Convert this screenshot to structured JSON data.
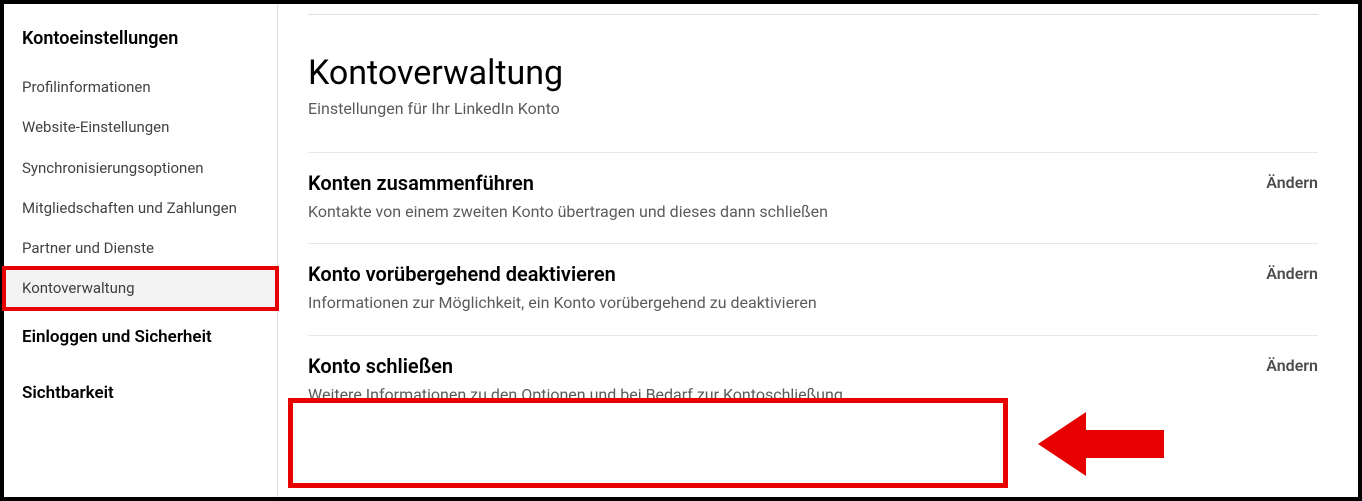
{
  "sidebar": {
    "group1_title": "Kontoeinstellungen",
    "items": [
      {
        "label": "Profilinformationen"
      },
      {
        "label": "Website-Einstellungen"
      },
      {
        "label": "Synchronisierungsoptionen"
      },
      {
        "label": "Mitgliedschaften und Zahlungen"
      },
      {
        "label": "Partner und Dienste"
      },
      {
        "label": "Kontoverwaltung"
      }
    ],
    "group2_title": "Einloggen und Sicherheit",
    "group3_title": "Sichtbarkeit"
  },
  "main": {
    "title": "Kontoverwaltung",
    "subtitle": "Einstellungen für Ihr LinkedIn Konto",
    "action_label": "Ändern",
    "rows": [
      {
        "title": "Konten zusammenführen",
        "desc": "Kontakte von einem zweiten Konto übertragen und dieses dann schließen"
      },
      {
        "title": "Konto vorübergehend deaktivieren",
        "desc": "Informationen zur Möglichkeit, ein Konto vorübergehend zu deaktivieren"
      },
      {
        "title": "Konto schließen",
        "desc": "Weitere Informationen zu den Optionen und bei Bedarf zur Kontoschließung"
      }
    ]
  }
}
